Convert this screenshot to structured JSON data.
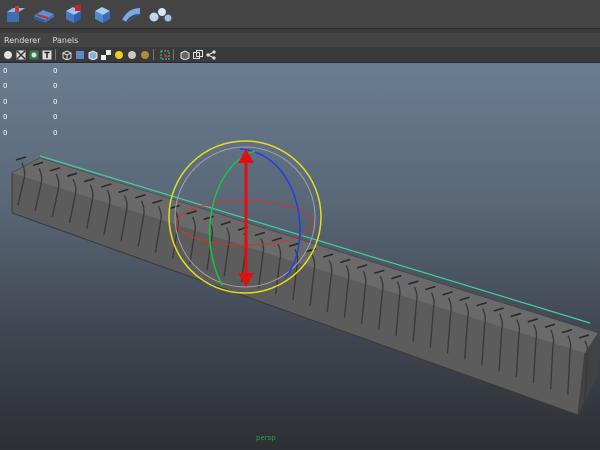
{
  "shelf": {
    "icons": [
      "cube-stack-icon",
      "paint-effects-icon",
      "red-cube-icon",
      "blue-cube-icon",
      "wave-plane-icon",
      "spheres-icon"
    ]
  },
  "panel_menu": {
    "items": [
      "Renderer",
      "Panels"
    ]
  },
  "hud": {
    "rows": [
      {
        "a": "0",
        "b": "0"
      },
      {
        "a": "0",
        "b": "0"
      },
      {
        "a": "0",
        "b": "0"
      },
      {
        "a": "0",
        "b": "0"
      },
      {
        "a": "0",
        "b": "0"
      }
    ]
  },
  "viewport": {
    "camera_label": "persp"
  },
  "colors": {
    "x_axis": "#e03020",
    "y_axis": "#20c040",
    "z_axis": "#2040e0",
    "outer_ring": "#e0e020",
    "move_arrow": "#e01010",
    "selection_line": "#40d0a0"
  }
}
